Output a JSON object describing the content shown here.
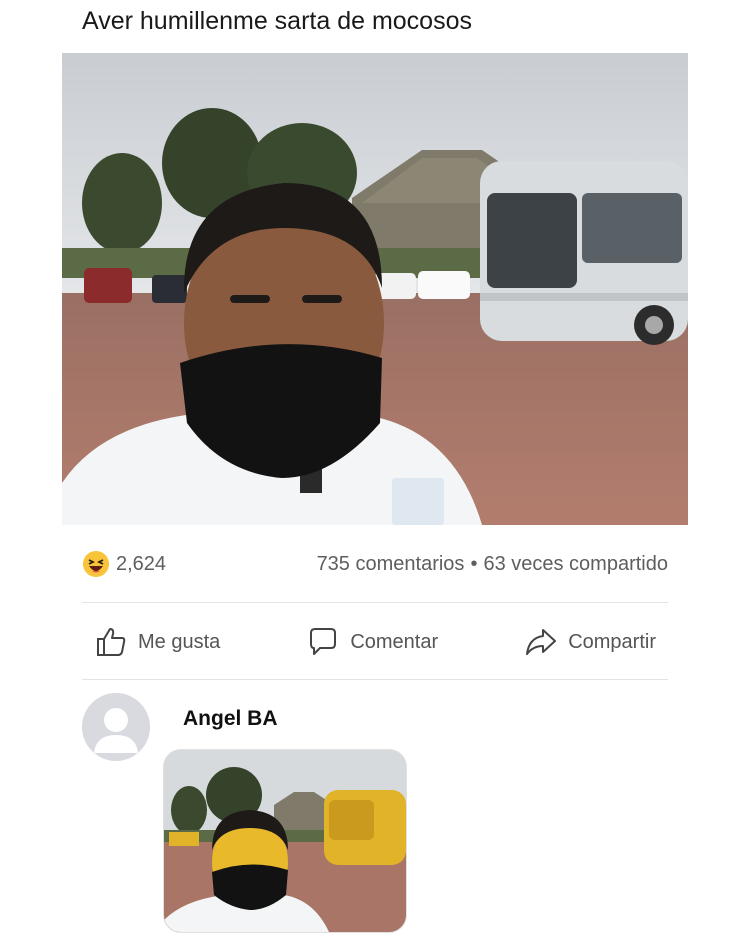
{
  "post": {
    "caption": "Aver humillenme sarta de mocosos",
    "photo_icon": "selfie-photo"
  },
  "stats": {
    "reaction_icon": "haha-emoji-icon",
    "reaction_count": "2,624",
    "comments": "735 comentarios",
    "separator": "•",
    "shares": "63 veces compartido"
  },
  "actions": {
    "like_label": "Me gusta",
    "comment_label": "Comentar",
    "share_label": "Compartir"
  },
  "comment": {
    "author": "Angel BA",
    "image_icon": "edited-selfie-photo"
  },
  "colors": {
    "haha_yellow": "#f7c43a",
    "text_gray": "#5e5e5e",
    "divider": "#e2e4e7",
    "avatar_bg": "#d8dadf"
  }
}
